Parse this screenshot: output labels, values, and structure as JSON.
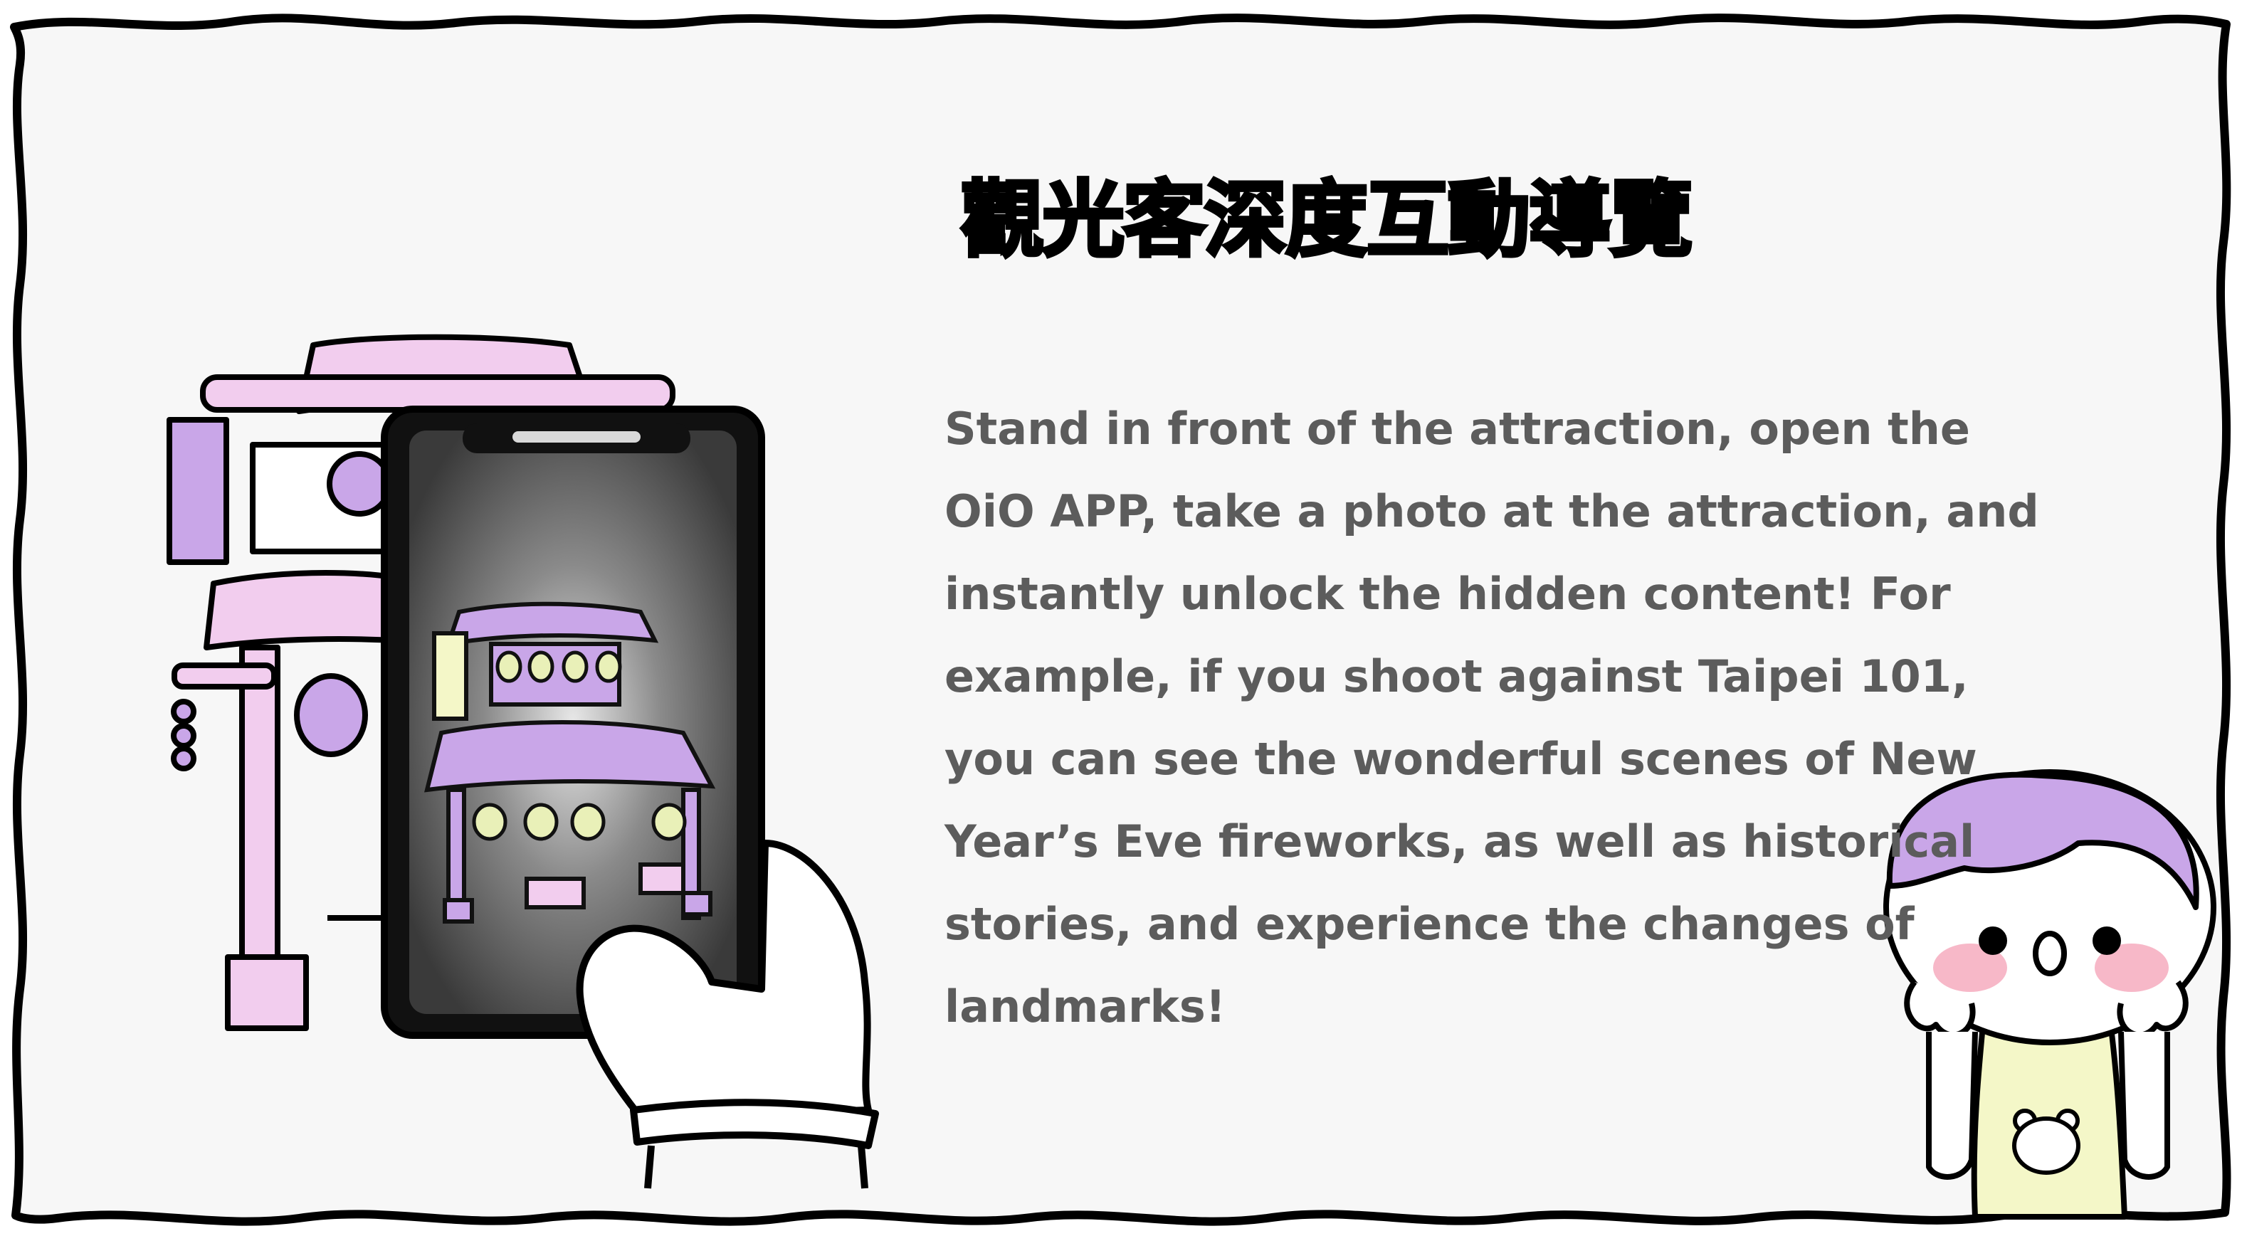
{
  "title": "觀光客深度互動導覽",
  "description_lines": [
    "Stand in front of the attraction, open the",
    "OiO APP, take a photo at the attraction, and",
    "instantly unlock the hidden content!  For",
    "example, if you shoot against Taipei 101,",
    "you can see the wonderful scenes of New",
    "Year’s Eve fireworks, as well as historical",
    "stories, and experience the changes of",
    "landmarks!"
  ],
  "colors": {
    "frame_background": "#f7f7f7",
    "frame_border": "#000000",
    "accent_purple": "#c9a6e8",
    "accent_pink": "#f2cdee",
    "text_gray": "#5c5c5c",
    "shirt_yellow": "#f4f7c8"
  },
  "icons": [
    "phone-illustration",
    "hand-illustration",
    "temple-gate-illustration",
    "child-character-illustration",
    "bear-face-icon"
  ]
}
